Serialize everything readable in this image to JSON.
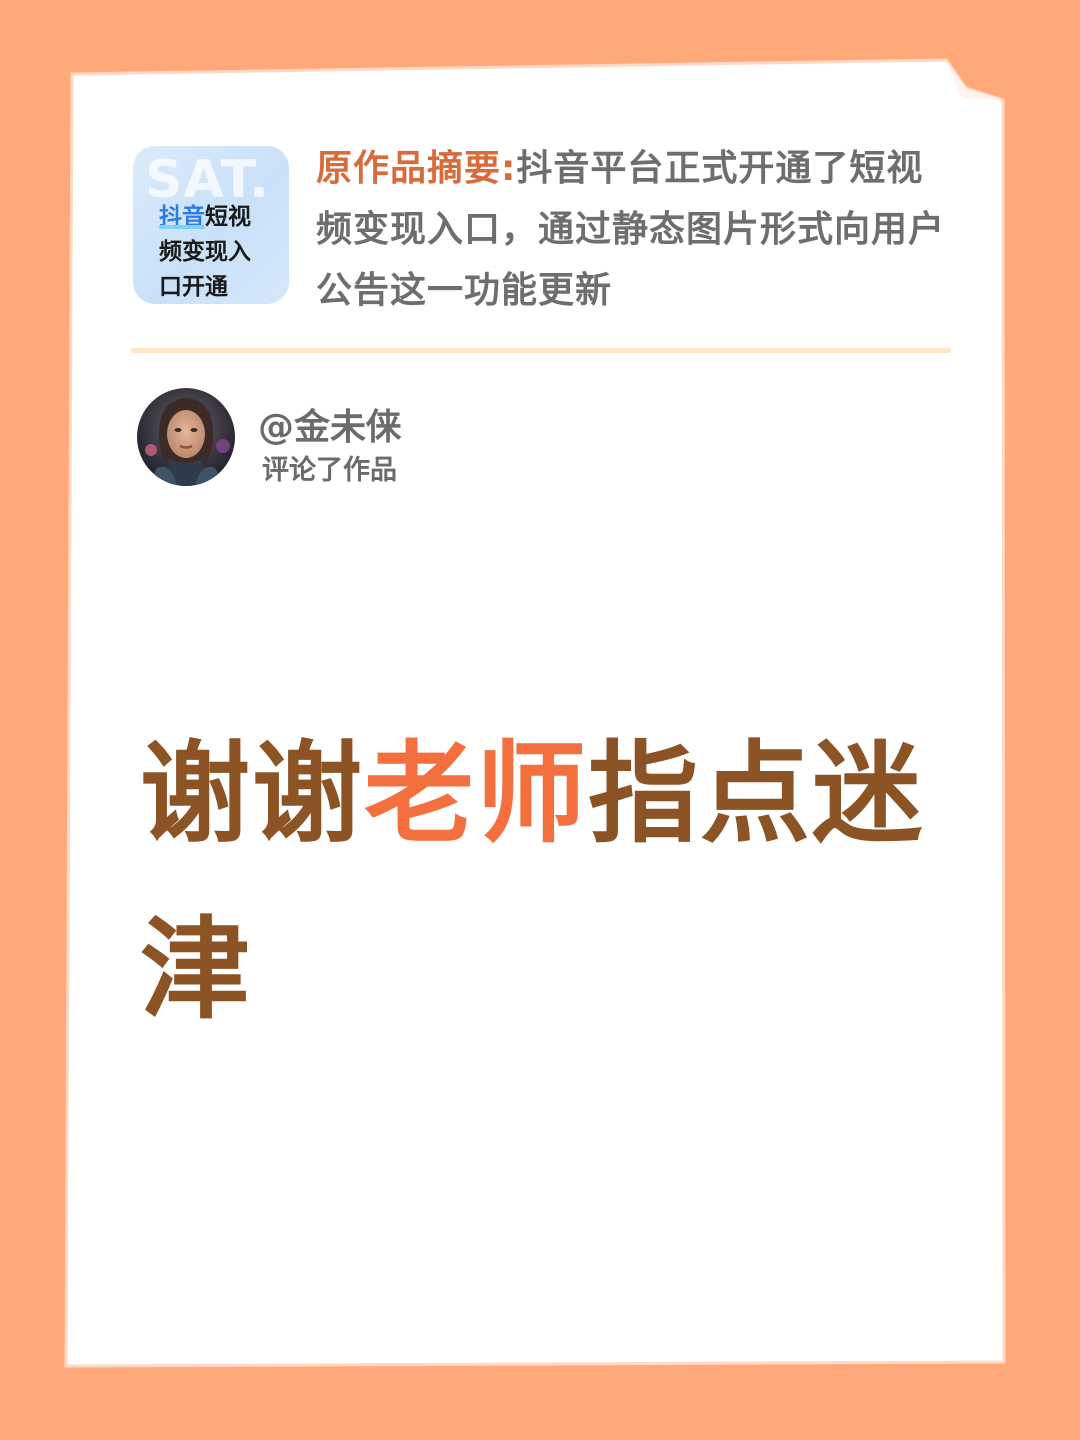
{
  "colors": {
    "background": "#FFA87A",
    "paper": "#FFFFFF",
    "summary_label": "#D96A3A",
    "summary_text": "#6E6E6E",
    "comment_text": "#8C5325",
    "comment_highlight": "#F46F3E",
    "divider": "#FCE8C6"
  },
  "thumbnail": {
    "watermark": "SAT.",
    "line1_highlight": "抖音",
    "line1_rest": "短视",
    "line2": "频变现入",
    "line3": "口开通"
  },
  "summary": {
    "label": "原作品摘要:",
    "text": "抖音平台正式开通了短视频变现入口，通过静态图片形式向用户公告这一功能更新"
  },
  "user": {
    "avatar_icon": "avatar-portrait",
    "name": "@金未俫",
    "action": "评论了作品"
  },
  "comment": {
    "before": "谢谢",
    "highlight": "老师",
    "after": "指点迷津"
  }
}
